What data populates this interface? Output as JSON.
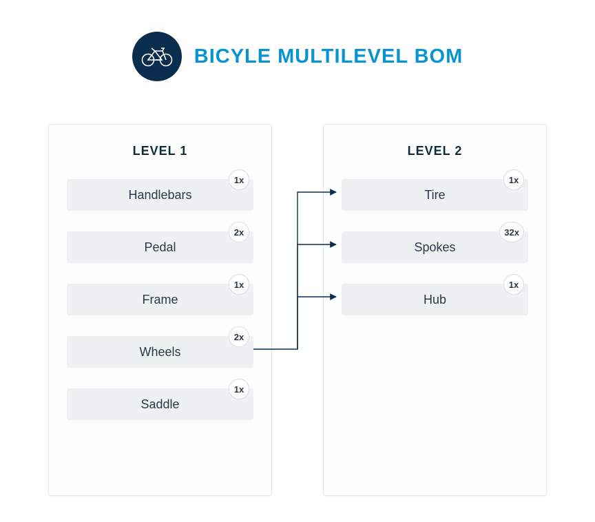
{
  "header": {
    "title": "BICYLE MULTILEVEL BOM",
    "icon": "bicycle-icon"
  },
  "colors": {
    "accent": "#0893d2",
    "dark": "#0b2d4d"
  },
  "levels": [
    {
      "title": "LEVEL 1",
      "items": [
        {
          "label": "Handlebars",
          "qty": "1x"
        },
        {
          "label": "Pedal",
          "qty": "2x"
        },
        {
          "label": "Frame",
          "qty": "1x"
        },
        {
          "label": "Wheels",
          "qty": "2x"
        },
        {
          "label": "Saddle",
          "qty": "1x"
        }
      ]
    },
    {
      "title": "LEVEL 2",
      "items": [
        {
          "label": "Tire",
          "qty": "1x"
        },
        {
          "label": "Spokes",
          "qty": "32x"
        },
        {
          "label": "Hub",
          "qty": "1x"
        }
      ]
    }
  ],
  "connections": {
    "from_level": 0,
    "from_item_index": 3,
    "to_level": 1,
    "to_item_indices": [
      0,
      1,
      2
    ]
  }
}
